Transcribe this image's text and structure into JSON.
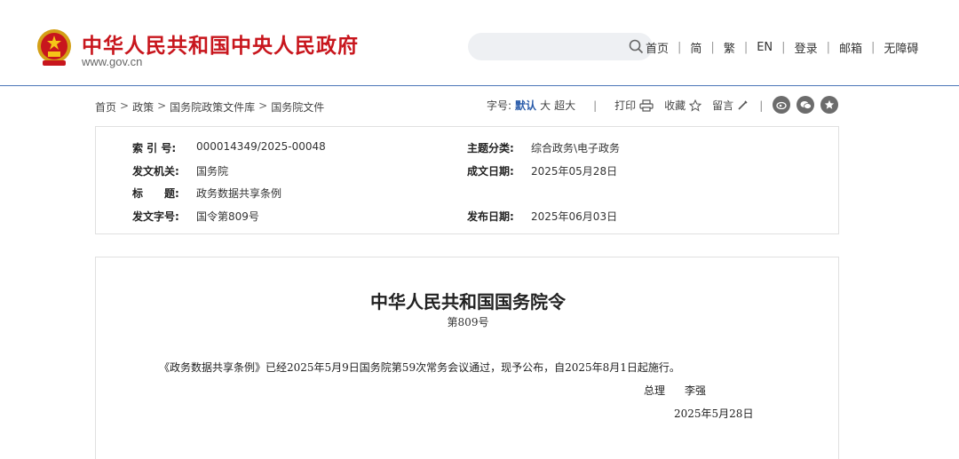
{
  "header": {
    "site_title": "中华人民共和国中央人民政府",
    "site_url": "www.gov.cn",
    "emblem_icon": "national-emblem-icon",
    "search": {
      "placeholder": "",
      "icon": "search-icon"
    },
    "nav": [
      "首页",
      "简",
      "繁",
      "EN",
      "登录",
      "邮箱",
      "无障碍"
    ],
    "accent_color": "#c8161d",
    "rule_color": "#4a76b8"
  },
  "breadcrumb": [
    "首页",
    "政策",
    "国务院政策文件库",
    "国务院文件"
  ],
  "tools": {
    "font_size_label": "字号:",
    "font_sizes": [
      "默认",
      "大",
      "超大"
    ],
    "active_font_size": "默认",
    "print_label": "打印",
    "favorite_label": "收藏",
    "comment_label": "留言",
    "share_icons": [
      "weibo-icon",
      "wechat-icon",
      "star-icon"
    ]
  },
  "info": {
    "index_no_label": "索 引 号:",
    "index_no": "000014349/2025-00048",
    "category_label": "主题分类:",
    "category": "综合政务\\电子政务",
    "issuer_label": "发文机关:",
    "issuer": "国务院",
    "date_written_label": "成文日期:",
    "date_written": "2025年05月28日",
    "title_label": "标　　题:",
    "title": "政务数据共享条例",
    "doc_no_label": "发文字号:",
    "doc_no": "国令第809号",
    "publish_date_label": "发布日期:",
    "publish_date": "2025年06月03日"
  },
  "document": {
    "title": "中华人民共和国国务院令",
    "number": "第809号",
    "body": "《政务数据共享条例》已经2025年5月9日国务院第59次常务会议通过，现予公布，自2025年8月1日起施行。",
    "signer_role": "总理",
    "signer_name": "李强",
    "sign_date": "2025年5月28日"
  }
}
